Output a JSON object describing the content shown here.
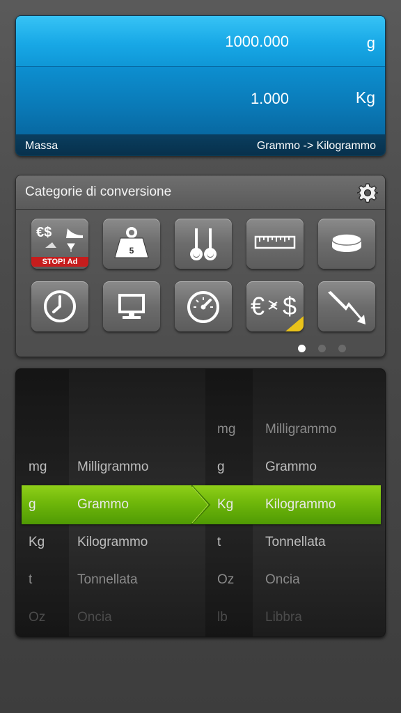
{
  "display": {
    "source_value": "1000.000",
    "source_unit": "g",
    "target_value": "1.000",
    "target_unit": "Kg",
    "category": "Massa",
    "conversion": "Grammo -> Kilogrammo"
  },
  "categories": {
    "title": "Categorie di conversione",
    "stop_ad_label": "STOP! Ad",
    "weight_number": "5",
    "page_count": 3,
    "active_page": 1
  },
  "picker": {
    "left_rows": [
      {
        "abbr": "mg",
        "name": "Milligrammo"
      },
      {
        "abbr": "g",
        "name": "Grammo"
      },
      {
        "abbr": "Kg",
        "name": "Kilogrammo"
      },
      {
        "abbr": "t",
        "name": "Tonnellata"
      },
      {
        "abbr": "Oz",
        "name": "Oncia"
      }
    ],
    "right_rows": [
      {
        "abbr": "mg",
        "name": "Milligrammo"
      },
      {
        "abbr": "g",
        "name": "Grammo"
      },
      {
        "abbr": "Kg",
        "name": "Kilogrammo"
      },
      {
        "abbr": "t",
        "name": "Tonnellata"
      },
      {
        "abbr": "Oz",
        "name": "Oncia"
      },
      {
        "abbr": "lb",
        "name": "Libbra"
      }
    ]
  },
  "colors": {
    "display_blue": "#18a8e6",
    "selection_green": "#6fb70a",
    "stop_red": "#c61d1d"
  }
}
